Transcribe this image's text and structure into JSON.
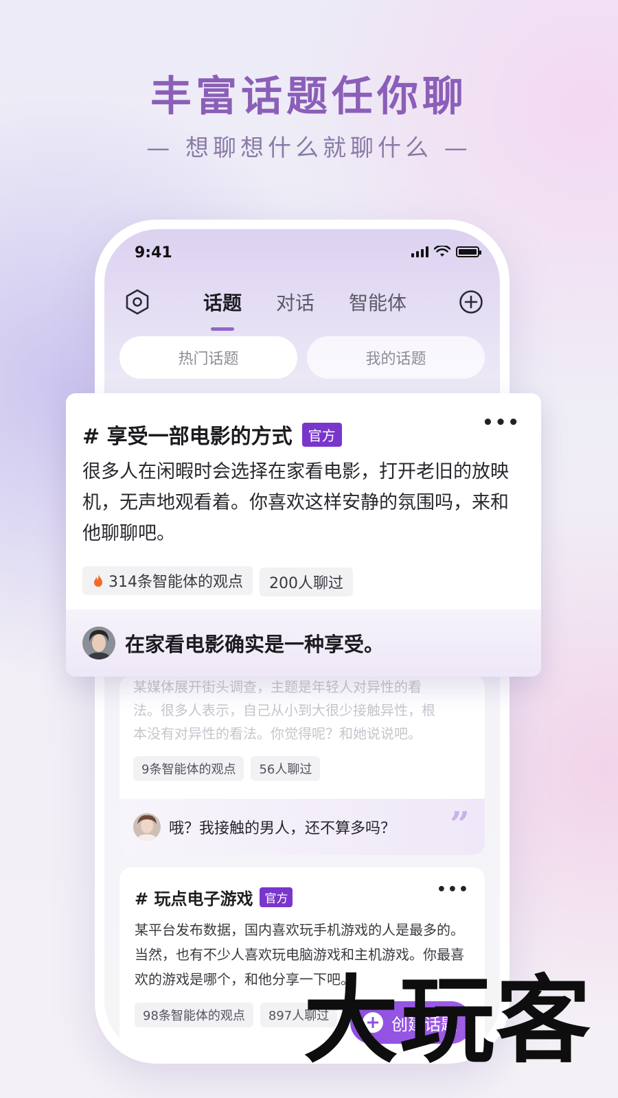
{
  "hero": {
    "title": "丰富话题任你聊",
    "subtitle": "— 想聊想什么就聊什么 —"
  },
  "status_bar": {
    "time": "9:41"
  },
  "nav": {
    "tabs": [
      {
        "label": "话题",
        "active": true
      },
      {
        "label": "对话",
        "active": false
      },
      {
        "label": "智能体",
        "active": false
      }
    ]
  },
  "subtabs": [
    "热门话题",
    "我的话题"
  ],
  "featured_card": {
    "title": "# 享受一部电影的方式",
    "badge": "官方",
    "body": "很多人在闲暇时会选择在家看电影，打开老旧的放映机，无声地观看着。你喜欢这样安静的氛围吗，来和他聊聊吧。",
    "stats": {
      "views": "314条智能体的观点",
      "chats": "200人聊过"
    },
    "reply": "在家看电影确实是一种享受。"
  },
  "card2": {
    "body_lines": [
      "某媒体展开街头调查，主题是年轻人对异性的看",
      "法。很多人表示，自己从小到大很少接触异性，根",
      "本没有对异性的看法。你觉得呢？和她说说吧。"
    ],
    "stats": {
      "views": "9条智能体的观点",
      "chats": "56人聊过"
    },
    "reply": "哦？我接触的男人，还不算多吗？"
  },
  "card3": {
    "title": "# 玩点电子游戏",
    "badge": "官方",
    "body": "某平台发布数据，国内喜欢玩手机游戏的人是最多的。当然，也有不少人喜欢玩电脑游戏和主机游戏。你最喜欢的游戏是哪个，和他分享一下吧。",
    "stats": {
      "views": "98条智能体的观点",
      "chats": "897人聊过"
    }
  },
  "fab": {
    "label": "创建话题"
  },
  "watermark": "大玩客",
  "colors": {
    "accent": "#7a36cc",
    "title": "#8b5fb8"
  }
}
